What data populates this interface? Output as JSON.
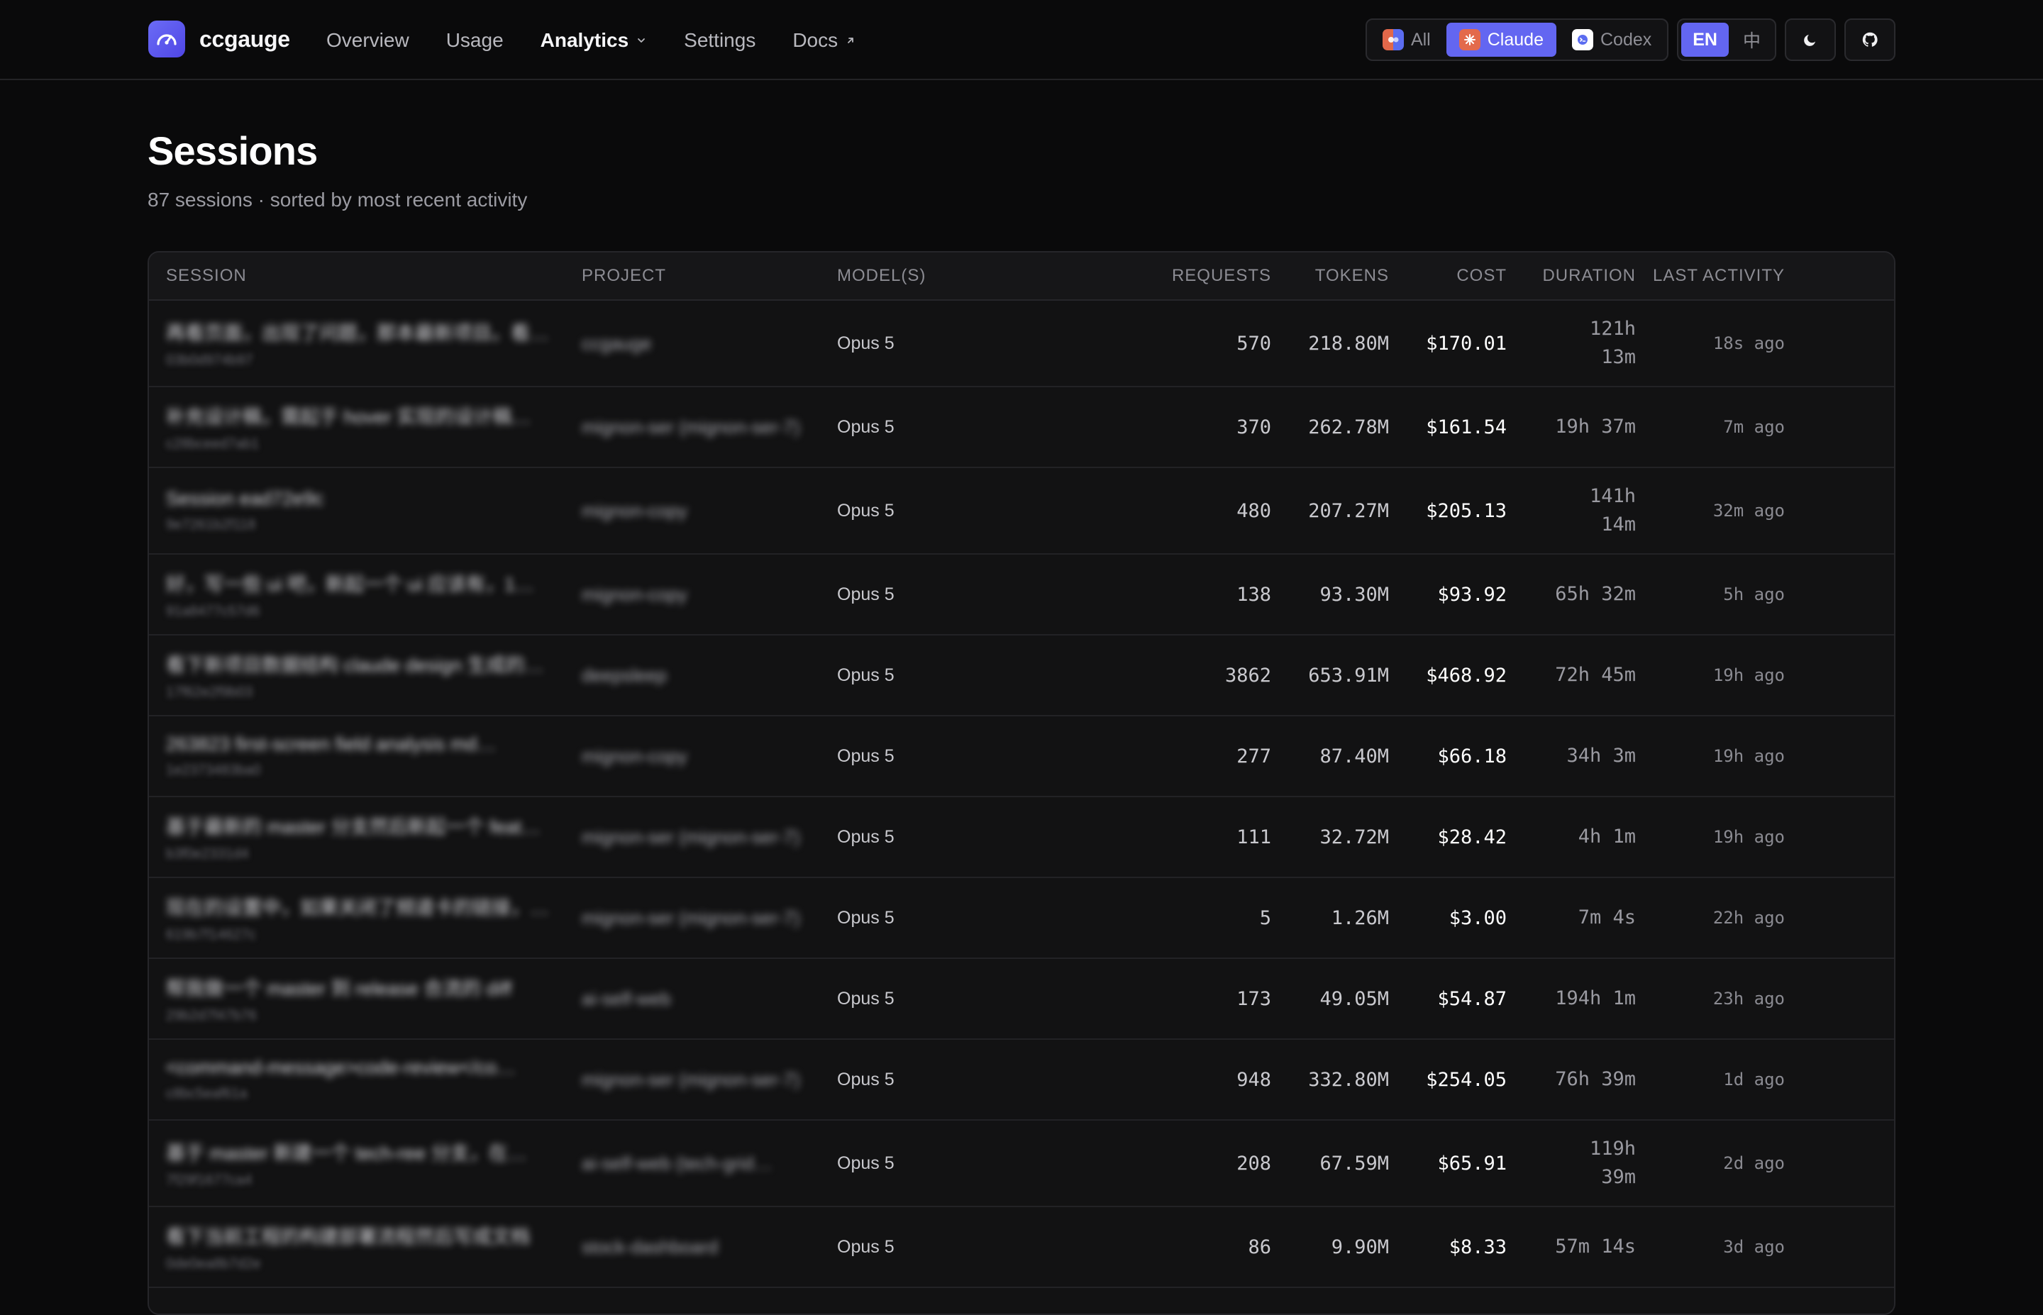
{
  "brand": {
    "name": "ccgauge"
  },
  "nav": {
    "overview": "Overview",
    "usage": "Usage",
    "analytics": "Analytics",
    "settings": "Settings",
    "docs": "Docs"
  },
  "source_filter": {
    "all": "All",
    "claude": "Claude",
    "codex": "Codex"
  },
  "language": {
    "en": "EN",
    "zh": "中"
  },
  "page": {
    "title": "Sessions",
    "subtitle": "87 sessions · sorted by most recent activity"
  },
  "table": {
    "headers": {
      "session": "SESSION",
      "project": "PROJECT",
      "models": "MODEL(S)",
      "requests": "REQUESTS",
      "tokens": "TOKENS",
      "cost": "COST",
      "duration": "DURATION",
      "last_activity": "LAST ACTIVITY"
    },
    "rows": [
      {
        "title": "再看页面，出现了问题，那本最新项目。看…",
        "id": "03b0d974b97",
        "project": "ccgauge",
        "model": "Opus 5",
        "requests": "570",
        "tokens": "218.80M",
        "cost": "$170.01",
        "duration": [
          "121h",
          "13m"
        ],
        "last": "18s ago"
      },
      {
        "title": "补充设计稿，需起于 hover 实现的设计稿…",
        "id": "c28bceed7ab1",
        "project": "mignon-ser (mignon-ser-7)",
        "model": "Opus 5",
        "requests": "370",
        "tokens": "262.78M",
        "cost": "$161.54",
        "duration": [
          "19h 37m"
        ],
        "last": "7m ago"
      },
      {
        "title": "Session ead72e9c",
        "id": "9e7261b2f118",
        "project": "mignon-copy",
        "model": "Opus 5",
        "requests": "480",
        "tokens": "207.27M",
        "cost": "$205.13",
        "duration": [
          "141h",
          "14m"
        ],
        "last": "32m ago"
      },
      {
        "title": "好，写一些 ui 吧，新起一个 ui 应该有，1…",
        "id": "91a8477c57d6",
        "project": "mignon-copy",
        "model": "Opus 5",
        "requests": "138",
        "tokens": "93.30M",
        "cost": "$93.92",
        "duration": [
          "65h 32m"
        ],
        "last": "5h ago"
      },
      {
        "title": "看下新项目数据结构 claude design 生成的…",
        "id": "17f62e2f9b03",
        "project": "deepsleep",
        "model": "Opus 5",
        "requests": "3862",
        "tokens": "653.91M",
        "cost": "$468.92",
        "duration": [
          "72h 45m"
        ],
        "last": "19h ago"
      },
      {
        "title": "263823 first-screen field analysis md…",
        "id": "1e2373483ba0",
        "project": "mignon-copy",
        "model": "Opus 5",
        "requests": "277",
        "tokens": "87.40M",
        "cost": "$66.18",
        "duration": [
          "34h 3m"
        ],
        "last": "19h ago"
      },
      {
        "title": "基于最新的 master 分支然后新起一个 feat…",
        "id": "b3f0e2331d4",
        "project": "mignon-ser (mignon-ser-7)",
        "model": "Opus 5",
        "requests": "111",
        "tokens": "32.72M",
        "cost": "$28.42",
        "duration": [
          "4h 1m"
        ],
        "last": "19h ago"
      },
      {
        "title": "现在的设置中，如果关闭了频道卡的链接，…",
        "id": "619b7f14627c",
        "project": "mignon-ser (mignon-ser-7)",
        "model": "Opus 5",
        "requests": "5",
        "tokens": "1.26M",
        "cost": "$3.00",
        "duration": [
          "7m 4s"
        ],
        "last": "22h ago"
      },
      {
        "title": "帮我做一个 master 到 release 合流的 diff",
        "id": "29b2d7f47b76",
        "project": "ai-self-web",
        "model": "Opus 5",
        "requests": "173",
        "tokens": "49.05M",
        "cost": "$54.87",
        "duration": [
          "194h 1m"
        ],
        "last": "23h ago"
      },
      {
        "title": "<command-message>code-review</co…",
        "id": "c8bc5eaf61a",
        "project": "mignon-ser (mignon-ser-7)",
        "model": "Opus 5",
        "requests": "948",
        "tokens": "332.80M",
        "cost": "$254.05",
        "duration": [
          "76h 39m"
        ],
        "last": "1d ago"
      },
      {
        "title": "基于 master 新建一个 tech-ree 分支，在…",
        "id": "7f29f1677ca4",
        "project": "ai-self-web (tech-grid…",
        "model": "Opus 5",
        "requests": "208",
        "tokens": "67.59M",
        "cost": "$65.91",
        "duration": [
          "119h",
          "39m"
        ],
        "last": "2d ago"
      },
      {
        "title": "看下当前工程的构建部署流程然后写成文档",
        "id": "0de0ea8b7d2e",
        "project": "stock-dashboard",
        "model": "Opus 5",
        "requests": "86",
        "tokens": "9.90M",
        "cost": "$8.33",
        "duration": [
          "57m 14s"
        ],
        "last": "3d ago"
      }
    ]
  }
}
